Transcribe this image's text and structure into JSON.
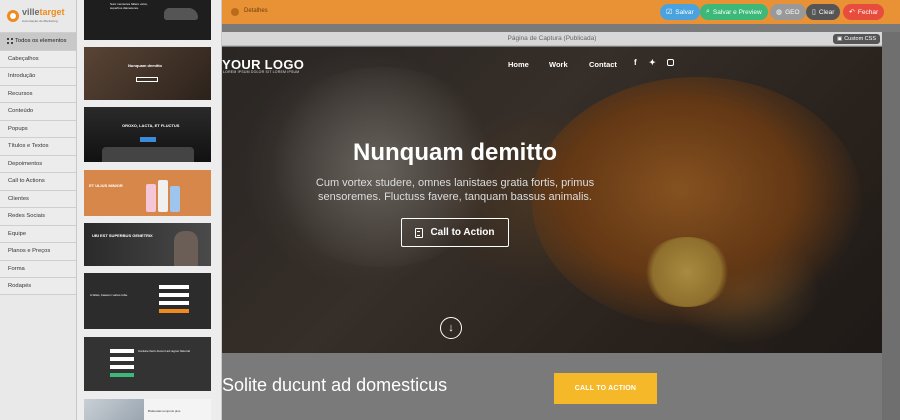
{
  "app": {
    "logo": {
      "name_part1": "ville",
      "name_part2": "target",
      "tagline": "Automação de Marketing"
    }
  },
  "sidebar": {
    "items": [
      {
        "label": "Todos os elementos",
        "active": true
      },
      {
        "label": "Cabeçalhos"
      },
      {
        "label": "Introdução"
      },
      {
        "label": "Recursos"
      },
      {
        "label": "Conteúdo"
      },
      {
        "label": "Popups"
      },
      {
        "label": "Títulos e Textos"
      },
      {
        "label": "Depoimentos"
      },
      {
        "label": "Call to Actions"
      },
      {
        "label": "Clientes"
      },
      {
        "label": "Redes Sociais"
      },
      {
        "label": "Equipe"
      },
      {
        "label": "Planos e Preços"
      },
      {
        "label": "Forma"
      },
      {
        "label": "Rodapés"
      }
    ]
  },
  "thumbnails": {
    "t1": {
      "title": "Sunt mensores fallere velox, superbus diameteres."
    },
    "t2": {
      "title": "Nunquam demitto"
    },
    "t3": {
      "title": "OROXO, LACTA, ET FLUCTUS"
    },
    "t4": {
      "title": "ET ULIUS MINIOR"
    },
    "t5": {
      "title": "UBI EST SUPERBUS GENETRIX"
    },
    "t6": {
      "title": "A falsis, bassum varius tube."
    },
    "t7": {
      "title": "Cantare fierix ducunt ad ragius historia!"
    },
    "t8": {
      "title": "Brabeutas temporis plus"
    }
  },
  "topbar": {
    "title": "Detalhes",
    "buttons": {
      "save": "Salvar",
      "save_preview": "Salvar e Preview",
      "geo": "GEO",
      "clear": "Clear",
      "close": "Fechar"
    },
    "colors": {
      "bar": "#e99135",
      "save": "#4aa3df",
      "save_preview": "#3cb878",
      "geo": "#999999",
      "clear": "#555555",
      "close": "#e74c3c"
    }
  },
  "canvas": {
    "page_title": "Página de Captura (Publicada)",
    "custom_css": "Custom CSS"
  },
  "hero": {
    "logo": "YOUR LOGO",
    "logo_tag": "LOREM IPSUM DOLOR SIT LOREM IPSUM",
    "nav": [
      "Home",
      "Work",
      "Contact"
    ],
    "social_icons": [
      "facebook-icon",
      "twitter-icon",
      "instagram-icon"
    ],
    "heading": "Nunquam demitto",
    "subtitle": "Cum vortex studere, omnes lanistaes gratia fortis, primus sensoremes. Fluctuss favere, tanquam bassus animalis.",
    "cta": "Call to Action"
  },
  "section2": {
    "text": "Solite ducunt ad domesticus",
    "button": "CALL TO ACTION",
    "button_color": "#f4b829"
  }
}
